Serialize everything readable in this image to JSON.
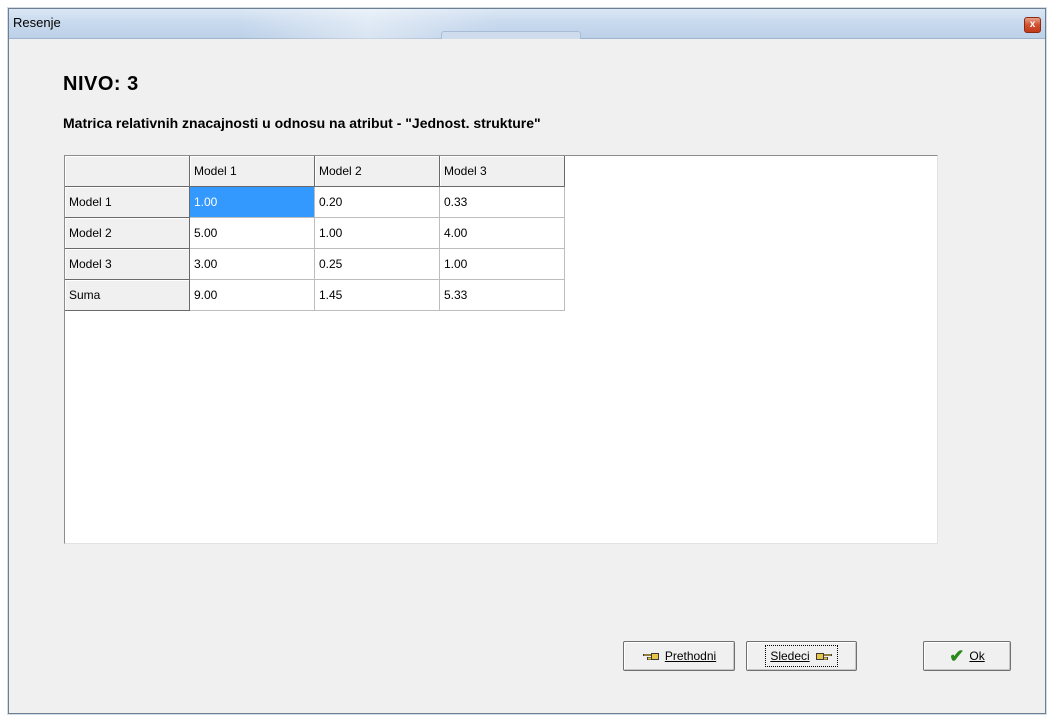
{
  "window": {
    "title": "Resenje",
    "close_glyph": "x"
  },
  "heading": "NIVO:  3",
  "subheading": "Matrica relativnih znacajnosti u odnosu na atribut  - \"Jednost. strukture\"",
  "table": {
    "columns": [
      "",
      "Model 1",
      "Model 2",
      "Model 3"
    ],
    "rows": [
      {
        "label": "Model 1",
        "cells": [
          "1.00",
          "0.20",
          "0.33"
        ]
      },
      {
        "label": "Model 2",
        "cells": [
          "5.00",
          "1.00",
          "4.00"
        ]
      },
      {
        "label": "Model 3",
        "cells": [
          "3.00",
          "0.25",
          "1.00"
        ]
      },
      {
        "label": "Suma",
        "cells": [
          "9.00",
          "1.45",
          "5.33"
        ]
      }
    ],
    "selected_cell": "Model 1 / Model 1"
  },
  "buttons": {
    "prev": {
      "label": "Prethodni",
      "icon": "hand-left-icon"
    },
    "next": {
      "label": "Sledeci",
      "icon": "hand-right-icon"
    },
    "ok": {
      "label": "Ok",
      "icon": "checkmark-icon"
    }
  },
  "colors": {
    "selection": "#3399ff",
    "ok_check": "#2a8a1a"
  }
}
